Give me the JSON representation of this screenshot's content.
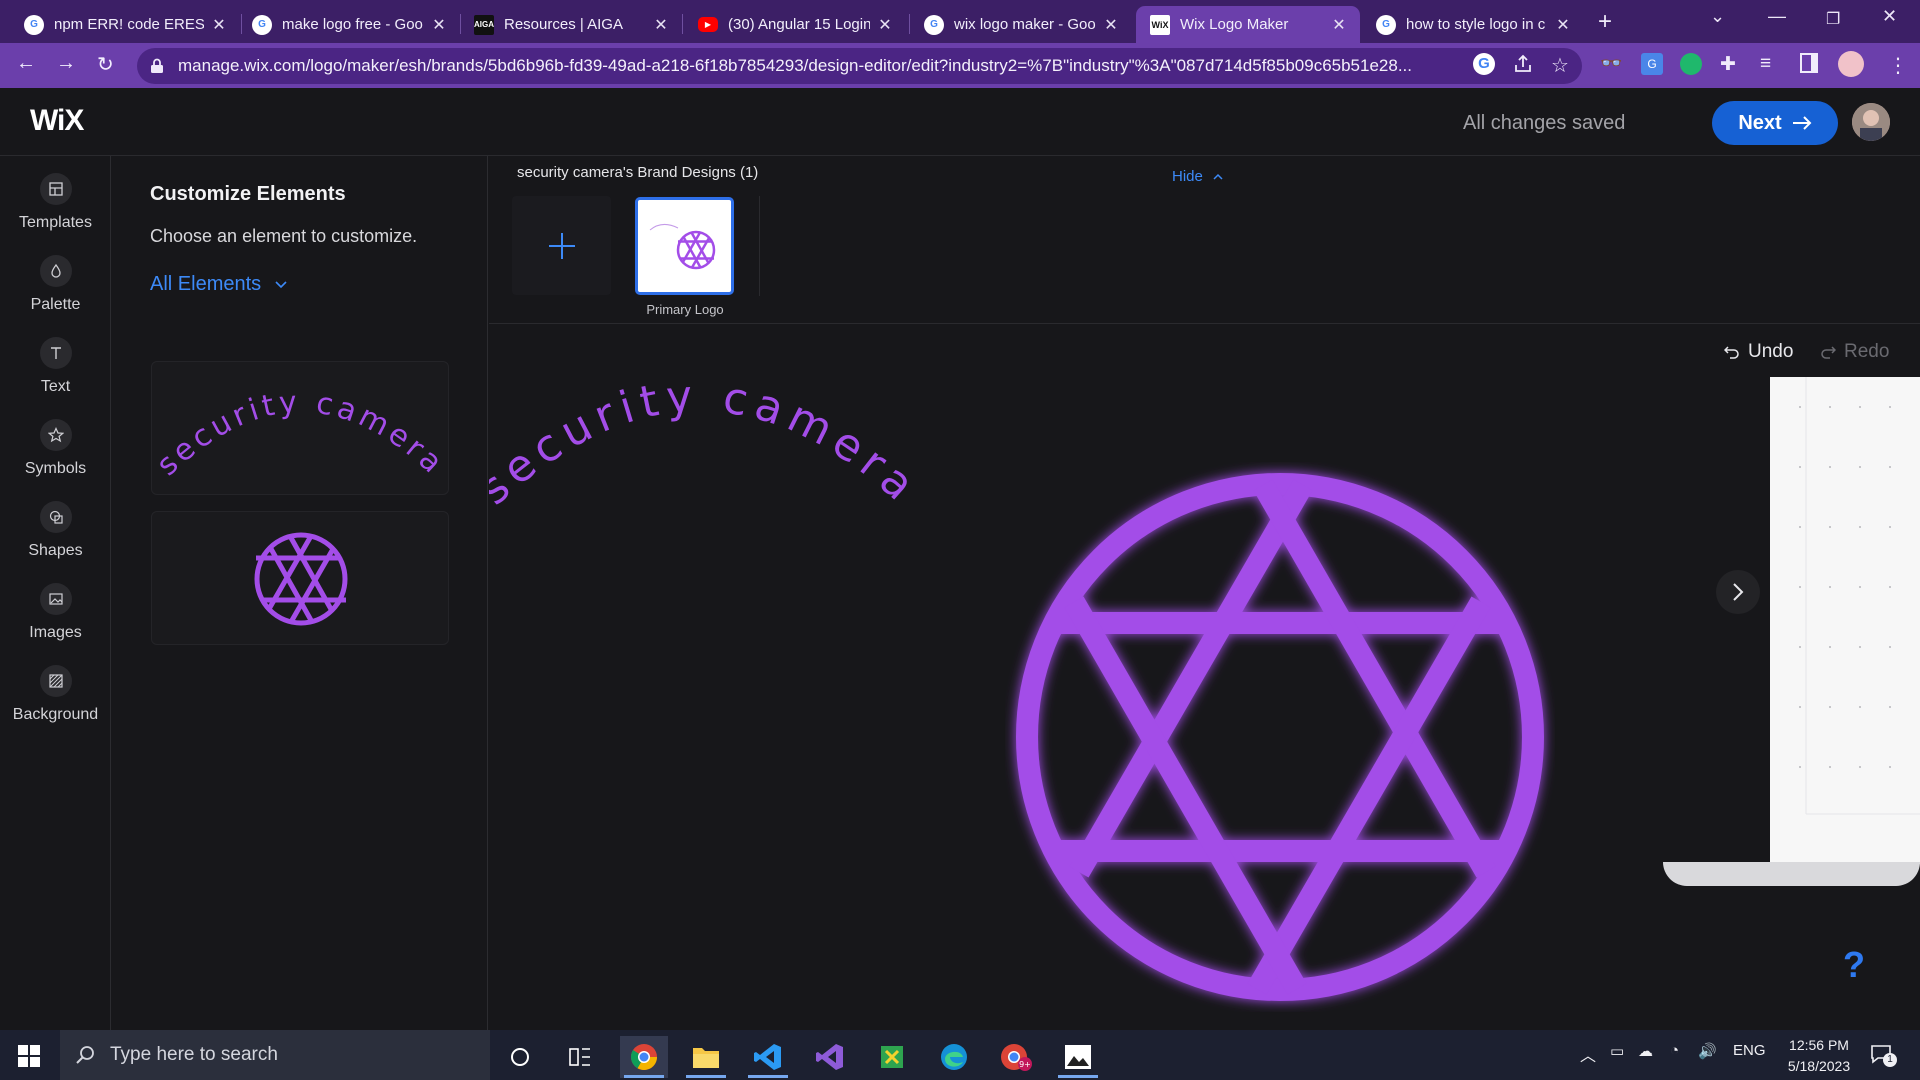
{
  "browser": {
    "tabs": [
      {
        "title": "npm ERR! code ERESC",
        "icon": "google-icon",
        "active": false
      },
      {
        "title": "make logo free - Goo",
        "icon": "google-icon",
        "active": false
      },
      {
        "title": "Resources | AIGA",
        "icon": "aiga-icon",
        "active": false
      },
      {
        "title": "(30) Angular 15 Login",
        "icon": "youtube-icon",
        "active": false
      },
      {
        "title": "wix logo maker - Goo",
        "icon": "google-icon",
        "active": false
      },
      {
        "title": "Wix Logo Maker",
        "icon": "wix-icon",
        "active": true
      },
      {
        "title": "how to style logo in c",
        "icon": "google-icon",
        "active": false
      }
    ],
    "url": "manage.wix.com/logo/maker/esh/brands/5bd6b96b-fd39-49ad-a218-6f18b7854293/design-editor/edit?industry2=%7B\"industry\"%3A\"087d714d5f85b09c65b51e28..."
  },
  "header": {
    "logo": "WiX",
    "save_status": "All changes saved",
    "next_label": "Next"
  },
  "rail": {
    "items": [
      {
        "label": "Templates",
        "icon": "templates-icon"
      },
      {
        "label": "Palette",
        "icon": "palette-icon"
      },
      {
        "label": "Text",
        "icon": "text-icon"
      },
      {
        "label": "Symbols",
        "icon": "symbols-icon"
      },
      {
        "label": "Shapes",
        "icon": "shapes-icon"
      },
      {
        "label": "Images",
        "icon": "images-icon"
      },
      {
        "label": "Background",
        "icon": "background-icon"
      }
    ]
  },
  "panel": {
    "title": "Customize Elements",
    "subtitle": "Choose an element to customize.",
    "filter": "All Elements"
  },
  "brand": {
    "title": "security camera's Brand Designs (1)",
    "hide": "Hide",
    "card_label": "Primary Logo"
  },
  "canvas": {
    "logo_text": "security camera",
    "undo": "Undo",
    "redo": "Redo",
    "help": "?",
    "accent": "#a34de8"
  },
  "taskbar": {
    "search_placeholder": "Type here to search",
    "lang": "ENG",
    "time": "12:56 PM",
    "date": "5/18/2023",
    "notif_count": "1"
  }
}
